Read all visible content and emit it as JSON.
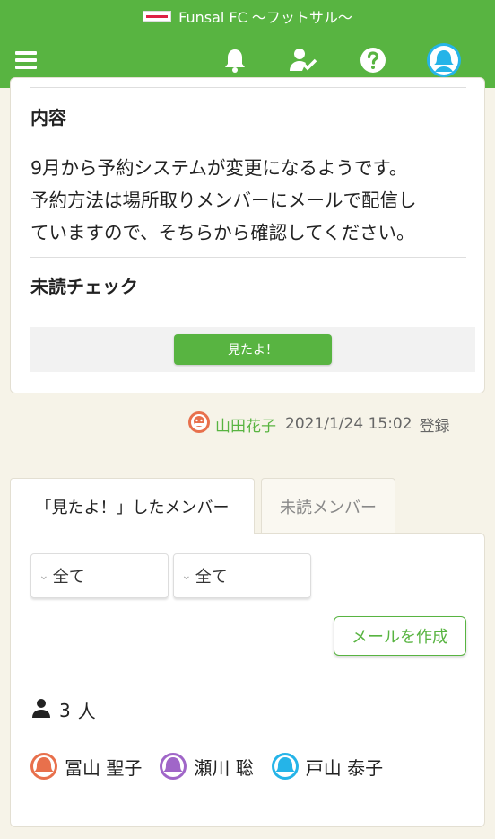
{
  "app": {
    "title": "Funsal FC 〜フットサル〜",
    "brand_color": "#58b441"
  },
  "nav": {
    "menu_icon": "hamburger-menu-icon",
    "icons": [
      "bell-icon",
      "user-check-icon",
      "help-icon",
      "profile-avatar-icon"
    ]
  },
  "post": {
    "content_heading": "内容",
    "content_lines": [
      "9月から予約システムが変更になるようです。",
      "予約方法は場所取りメンバーにメールで配信し",
      "ていますので、そちらから確認してください。"
    ],
    "unread_heading": "未読チェック",
    "seen_button": "見たよ！"
  },
  "meta": {
    "author": "山田花子",
    "date": "2021/1/24 15:02",
    "suffix": "登録"
  },
  "tabs": {
    "active": "「見たよ！」したメンバー",
    "inactive": "未読メンバー"
  },
  "filters": [
    "全て",
    "全て"
  ],
  "mail_button": "メールを作成",
  "count": {
    "value": "3",
    "unit": "人"
  },
  "members": [
    {
      "name": "冨山 聖子",
      "color": "#e8704c"
    },
    {
      "name": "瀬川 聡",
      "color": "#a066c8"
    },
    {
      "name": "戸山 泰子",
      "color": "#25b4e8"
    }
  ]
}
